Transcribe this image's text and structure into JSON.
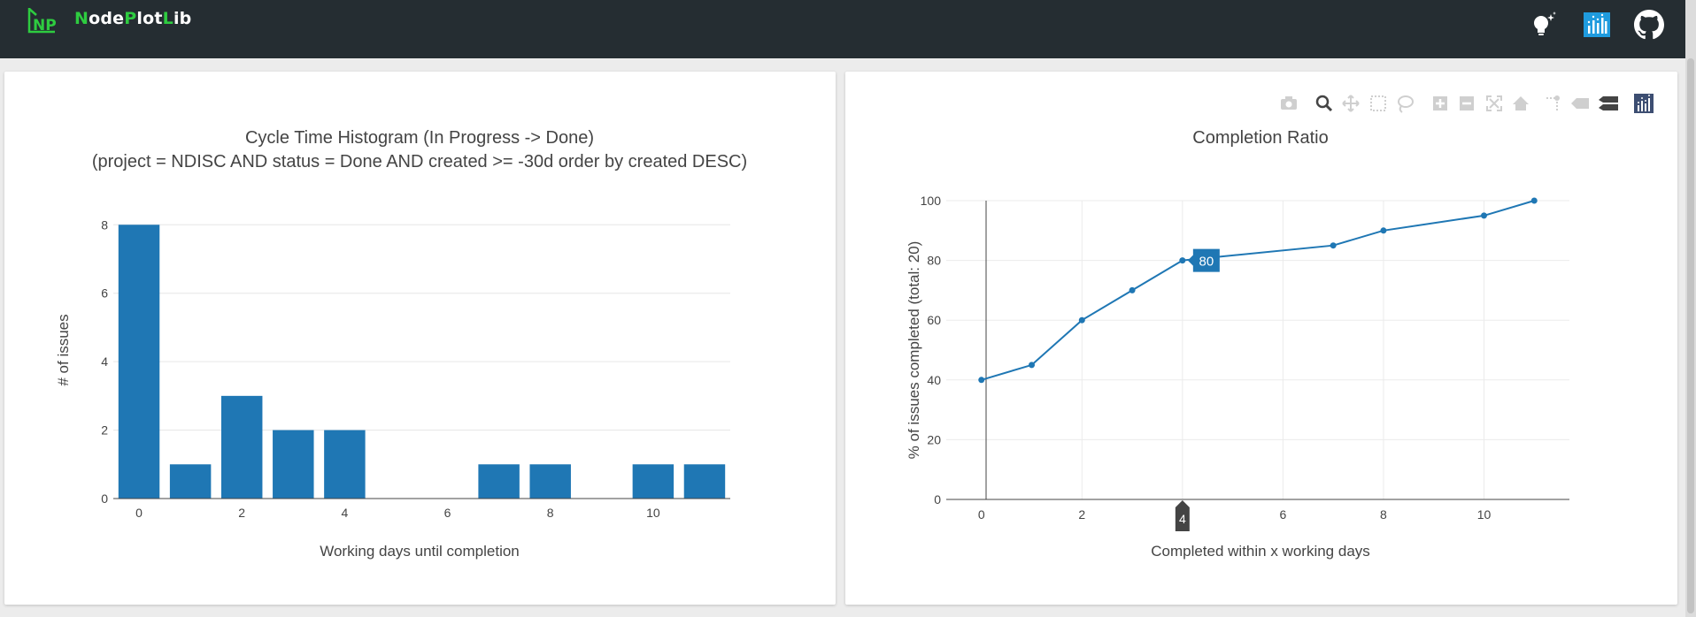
{
  "app": {
    "brand_parts": [
      {
        "text": "N",
        "hl": true
      },
      {
        "text": "ode",
        "hl": false
      },
      {
        "text": "P",
        "hl": true
      },
      {
        "text": "lot",
        "hl": false
      },
      {
        "text": "L",
        "hl": true
      },
      {
        "text": "ib",
        "hl": false
      }
    ],
    "logo_letters": "NP",
    "nav_icons": [
      "lightbulb-icon",
      "chart-icon",
      "github-icon"
    ],
    "colors": {
      "navbar": "#252d32",
      "accent": "#2ecc40",
      "bar": "#1f77b4",
      "chart_icon": "#1f9bde"
    }
  },
  "modebar": {
    "buttons": [
      "camera-icon",
      "zoom-icon",
      "pan-icon",
      "box-select-icon",
      "lasso-select-icon",
      "zoom-in-icon",
      "zoom-out-icon",
      "autoscale-icon",
      "reset-axes-icon",
      "spike-lines-icon",
      "hover-closest-icon",
      "hover-compare-icon",
      "plotly-logo-icon"
    ],
    "active": "zoom-icon"
  },
  "chart_data": [
    {
      "type": "bar",
      "title": "Cycle Time Histogram (In Progress -> Done)",
      "subtitle": "(project = NDISC AND status = Done AND created >= -30d order by created DESC)",
      "xlabel": "Working days until completion",
      "ylabel": "# of issues",
      "x": [
        0,
        1,
        2,
        3,
        4,
        7,
        8,
        10,
        11
      ],
      "values": [
        8,
        1,
        3,
        2,
        2,
        1,
        1,
        1,
        1
      ],
      "xlim": [
        -0.5,
        11.5
      ],
      "ylim": [
        0,
        8.42
      ],
      "xticks": [
        0,
        2,
        4,
        6,
        8,
        10
      ],
      "yticks": [
        0,
        2,
        4,
        6,
        8
      ],
      "grid": true,
      "color": "#1f77b4"
    },
    {
      "type": "line",
      "title": "Completion Ratio",
      "xlabel": "Completed within x working days",
      "ylabel": "% of issues completed (total: 20)",
      "x": [
        0,
        1,
        2,
        3,
        4,
        7,
        8,
        10,
        11
      ],
      "y": [
        40,
        45,
        60,
        70,
        80,
        85,
        90,
        95,
        100
      ],
      "xlim": [
        -0.7,
        11.7
      ],
      "ylim": [
        0,
        100
      ],
      "xticks": [
        0,
        2,
        4,
        6,
        8,
        10
      ],
      "yticks": [
        0,
        20,
        40,
        60,
        80,
        100
      ],
      "grid": true,
      "color": "#1f77b4",
      "hover": {
        "x": 4,
        "x_label": "4",
        "y_label": "80"
      }
    }
  ]
}
